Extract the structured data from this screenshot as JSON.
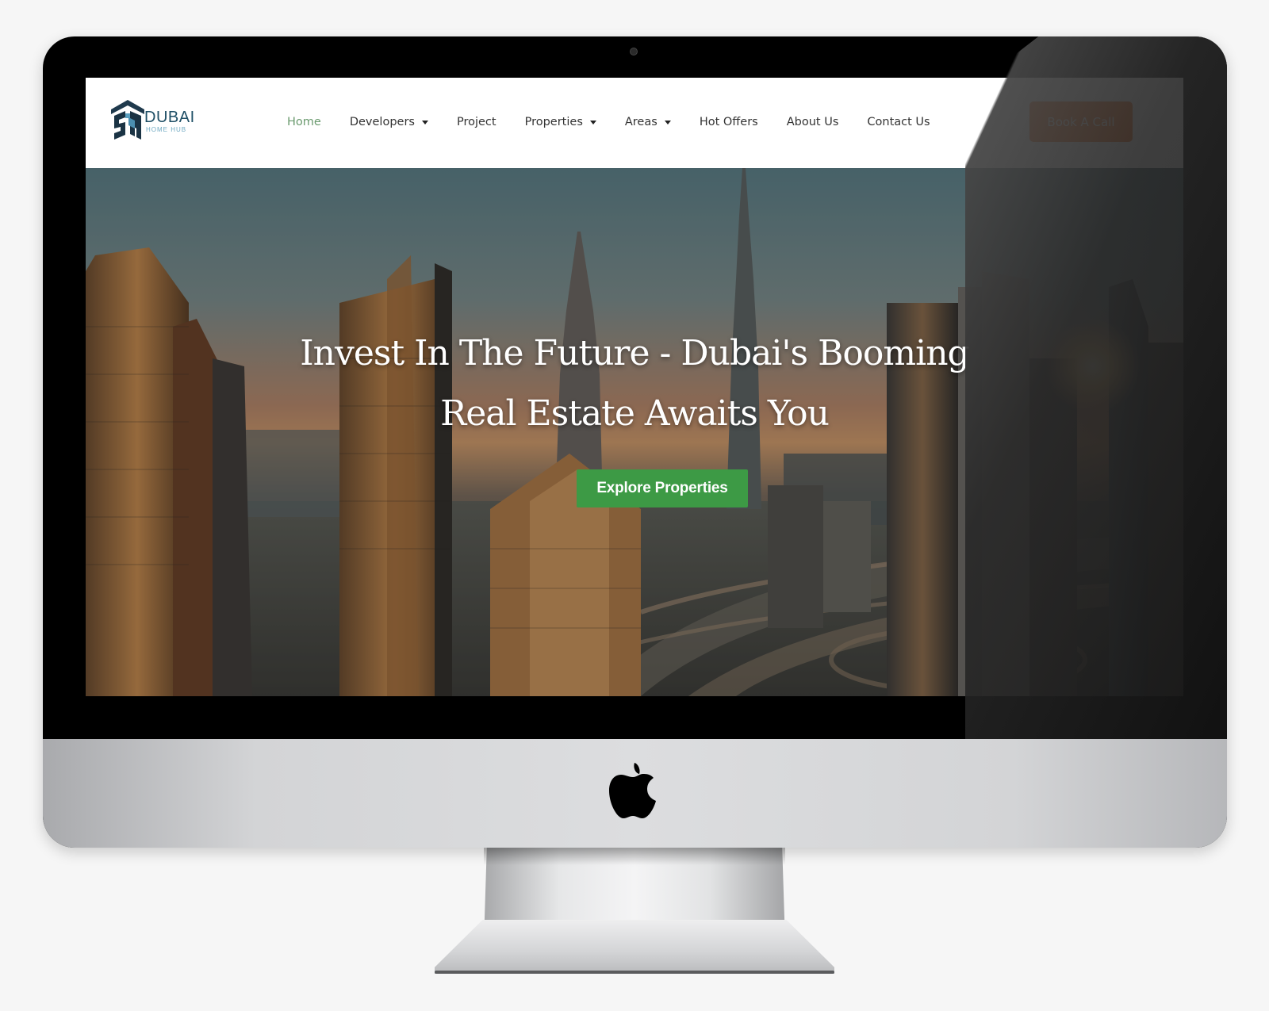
{
  "site": {
    "logo_word": "DUBAI",
    "logo_sub": "HOME HUB"
  },
  "nav": {
    "items": [
      {
        "label": "Home",
        "active": true,
        "dropdown": false
      },
      {
        "label": "Developers",
        "active": false,
        "dropdown": true
      },
      {
        "label": "Project",
        "active": false,
        "dropdown": false
      },
      {
        "label": "Properties",
        "active": false,
        "dropdown": true
      },
      {
        "label": "Areas",
        "active": false,
        "dropdown": true
      },
      {
        "label": "Hot Offers",
        "active": false,
        "dropdown": false
      },
      {
        "label": "About Us",
        "active": false,
        "dropdown": false
      },
      {
        "label": "Contact Us",
        "active": false,
        "dropdown": false
      }
    ],
    "cta_label": "Book A Call"
  },
  "hero": {
    "title_line1": "Invest In The Future - Dubai's Booming",
    "title_line2": "Real Estate Awaits You",
    "button_label": "Explore Properties"
  },
  "colors": {
    "accent_orange": "#f96a16",
    "accent_green": "#3d9a45",
    "active_nav": "#6a9a6e",
    "logo_navy": "#1f4f66"
  }
}
